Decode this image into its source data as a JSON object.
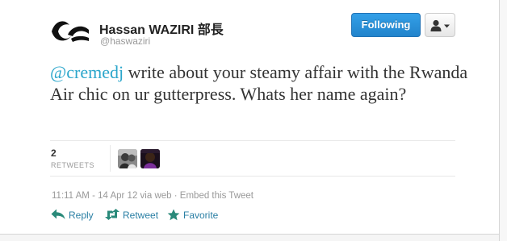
{
  "user": {
    "display_name": "Hassan WAZIRI 部長",
    "screen_name_at": "@",
    "screen_name": "haswaziri"
  },
  "buttons": {
    "follow_label": "Following",
    "user_actions_icon": "person-dropdown-icon"
  },
  "tweet": {
    "mention": "@cremedj",
    "text": " write about your steamy affair with the Rwanda Air chic on ur gutterpress. Whats her name again?"
  },
  "stats": {
    "retweet_count": "2",
    "retweet_label": "RETWEETS"
  },
  "meta": {
    "time": "11:11 AM - 14 Apr 12",
    "via": "via web",
    "separator": "·",
    "embed": "Embed this Tweet"
  },
  "actions": {
    "reply": "Reply",
    "retweet": "Retweet",
    "favorite": "Favorite"
  },
  "colors": {
    "accent": "#2ba6cb",
    "action": "#2a7fa4",
    "favorite_star": "#2a8a7a",
    "follow_button": "#2284cc"
  }
}
